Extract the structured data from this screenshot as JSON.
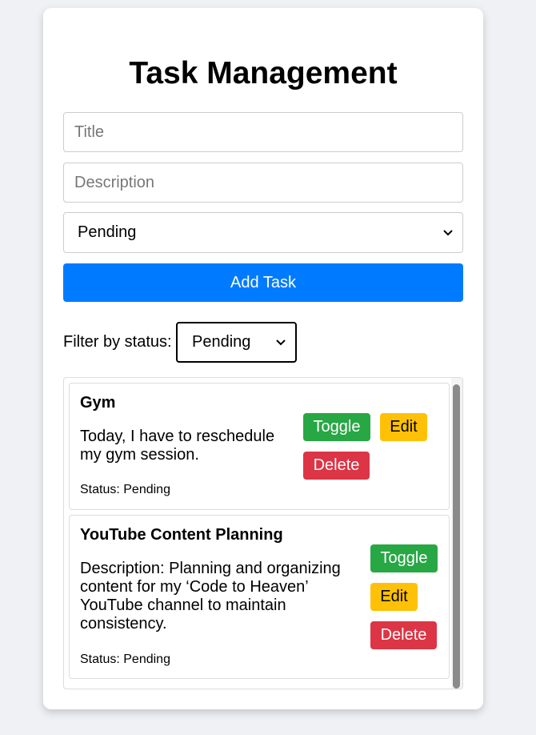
{
  "app": {
    "title": "Task Management"
  },
  "form": {
    "title_placeholder": "Title",
    "title_value": "",
    "description_placeholder": "Description",
    "description_value": "",
    "status_selected": "Pending",
    "add_button_label": "Add Task"
  },
  "filter": {
    "label": "Filter by status:",
    "selected": "Pending"
  },
  "tasks": [
    {
      "title": "Gym",
      "description_lines": [
        "Today, I have to reschedule",
        "my gym session."
      ],
      "status": "Status: Pending",
      "actions": {
        "toggle": "Toggle",
        "edit": "Edit",
        "delete": "Delete"
      }
    },
    {
      "title": "YouTube Content Planning",
      "description_lines": [
        "Description: Planning and organizing",
        "content for my ‘Code to Heaven’",
        "YouTube channel to maintain",
        "consistency."
      ],
      "status": "Status: Pending",
      "actions": {
        "toggle": "Toggle",
        "edit": "Edit",
        "delete": "Delete"
      }
    }
  ],
  "colors": {
    "primary": "#007bff",
    "toggle": "#28a745",
    "edit": "#ffc107",
    "delete": "#dc3545",
    "background": "#eff1f5"
  }
}
